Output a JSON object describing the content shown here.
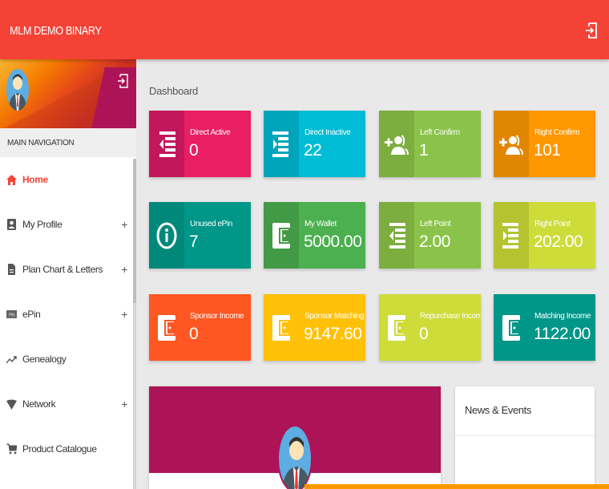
{
  "app": {
    "title": "MLM DEMO BINARY",
    "logout_icon": "logout-icon",
    "accent_color": "#f44336"
  },
  "sidebar": {
    "section_title": "MAIN NAVIGATION",
    "items": [
      {
        "label": "Home",
        "icon": "home-icon",
        "expandable": false,
        "active": true
      },
      {
        "label": "My Profile",
        "icon": "profile-icon",
        "expandable": true,
        "active": false
      },
      {
        "label": "Plan Chart & Letters",
        "icon": "document-icon",
        "expandable": true,
        "active": false
      },
      {
        "label": "ePin",
        "icon": "pin-icon",
        "expandable": true,
        "active": false
      },
      {
        "label": "Genealogy",
        "icon": "trending-icon",
        "expandable": false,
        "active": false
      },
      {
        "label": "Network",
        "icon": "network-icon",
        "expandable": true,
        "active": false
      },
      {
        "label": "Product Catalogue",
        "icon": "cart-icon",
        "expandable": false,
        "active": false
      }
    ],
    "expand_symbol": "+"
  },
  "main": {
    "breadcrumb": "Dashboard",
    "cards": [
      {
        "label": "Direct Active",
        "value": "0",
        "icon": "indent-left-icon",
        "color": "#e91e63",
        "icon_bg": "#c2185b"
      },
      {
        "label": "Direct Inactive",
        "value": "22",
        "icon": "indent-right-icon",
        "color": "#00bcd4",
        "icon_bg": "#00a5bb"
      },
      {
        "label": "Left Confirm",
        "value": "1",
        "icon": "add-group-icon",
        "color": "#8bc34a",
        "icon_bg": "#7cad3f"
      },
      {
        "label": "Right Confirm",
        "value": "101",
        "icon": "add-group-icon",
        "color": "#ff9800",
        "icon_bg": "#e08600"
      },
      {
        "label": "Unused ePin",
        "value": "7",
        "icon": "info-icon",
        "color": "#009688",
        "icon_bg": "#00887a"
      },
      {
        "label": "My Wallet",
        "value": "5000.00",
        "icon": "wallet-icon",
        "color": "#4caf50",
        "icon_bg": "#439a46"
      },
      {
        "label": "Left Point",
        "value": "2.00",
        "icon": "indent-left-icon",
        "color": "#8bc34a",
        "icon_bg": "#7cad3f"
      },
      {
        "label": "Right Point",
        "value": "202.00",
        "icon": "indent-right-icon",
        "color": "#cddc39",
        "icon_bg": "#b5c331"
      },
      {
        "label": "Sponsor Income",
        "value": "0",
        "icon": "wallet-icon",
        "color": "#ff5722",
        "icon_bg": "#ff5722"
      },
      {
        "label": "Sponsor Matching",
        "value": "9147.60",
        "icon": "wallet-icon",
        "color": "#ffc107",
        "icon_bg": "#ffc107"
      },
      {
        "label": "Repurchase Income",
        "value": "0",
        "icon": "wallet-icon",
        "color": "#cddc39",
        "icon_bg": "#cddc39"
      },
      {
        "label": "Matching Income",
        "value": "1122.00",
        "icon": "wallet-icon",
        "color": "#009688",
        "icon_bg": "#009688"
      }
    ],
    "news_title": "News & Events"
  }
}
